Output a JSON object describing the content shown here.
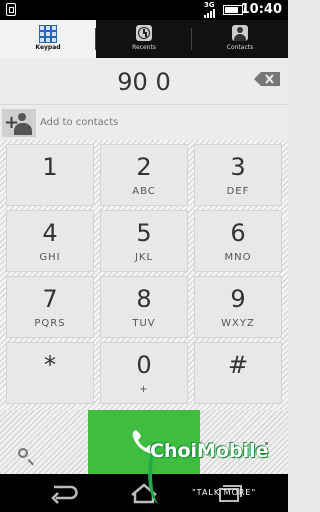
{
  "status_bar": {
    "network": "3G",
    "time": "10:40",
    "battery_level": 0.85
  },
  "tabs": [
    {
      "label": "Keypad",
      "icon": "keypad-icon",
      "active": true
    },
    {
      "label": "Recents",
      "icon": "clock-icon",
      "active": false
    },
    {
      "label": "Contacts",
      "icon": "person-icon",
      "active": false
    }
  ],
  "display": {
    "number": "90 0"
  },
  "add_contact": {
    "label": "Add to contacts"
  },
  "keys": [
    {
      "digit": "1",
      "letters": ""
    },
    {
      "digit": "2",
      "letters": "ABC"
    },
    {
      "digit": "3",
      "letters": "DEF"
    },
    {
      "digit": "4",
      "letters": "GHI"
    },
    {
      "digit": "5",
      "letters": "JKL"
    },
    {
      "digit": "6",
      "letters": "MNO"
    },
    {
      "digit": "7",
      "letters": "PQRS"
    },
    {
      "digit": "8",
      "letters": "TUV"
    },
    {
      "digit": "9",
      "letters": "WXYZ"
    },
    {
      "digit": "*",
      "letters": ""
    },
    {
      "digit": "0",
      "letters": "+"
    },
    {
      "digit": "#",
      "letters": ""
    }
  ],
  "colors": {
    "call_button": "#3fbd3f",
    "active_tab": "#f3f3f3"
  },
  "watermark": {
    "brand": "ChoiMobile",
    "tagline": "\"TALK MORE\""
  }
}
